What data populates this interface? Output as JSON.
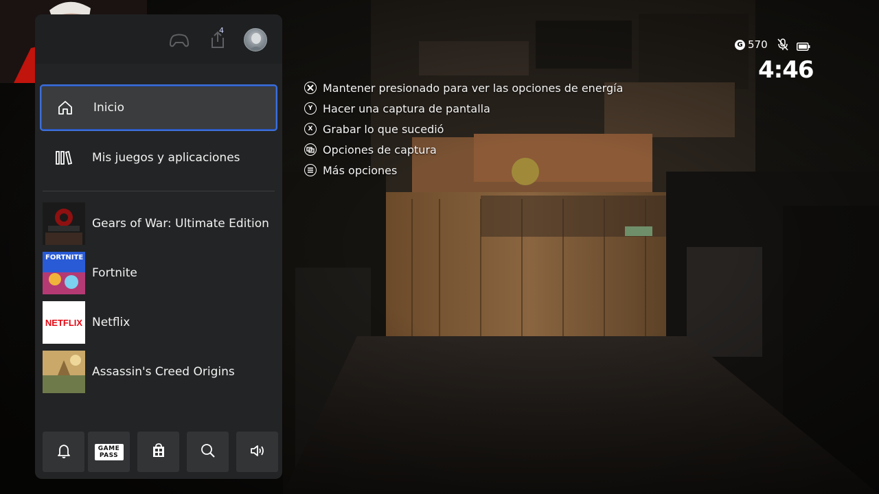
{
  "guide": {
    "notification_count": "4",
    "nav": [
      {
        "label": "Inicio",
        "icon": "home-icon"
      },
      {
        "label": "Mis juegos y aplicaciones",
        "icon": "library-icon"
      }
    ],
    "recent": [
      {
        "label": "Gears of War: Ultimate Edition",
        "thumb": "gears-of-war-thumbnail"
      },
      {
        "label": "Fortnite",
        "thumb": "fortnite-thumbnail",
        "thumb_text": "FORTNITE"
      },
      {
        "label": "Netflix",
        "thumb": "netflix-thumbnail",
        "thumb_text": "NETFLIX"
      },
      {
        "label": "Assassin's Creed Origins",
        "thumb": "assassins-creed-thumbnail"
      }
    ],
    "bottom_bar": {
      "notifications_icon": "bell-icon",
      "gamepass_line1": "GAME",
      "gamepass_line2": "PASS",
      "store_icon": "store-icon",
      "search_icon": "search-icon",
      "audio_icon": "speaker-icon"
    }
  },
  "hints": [
    {
      "button": "xbox",
      "text": "Mantener presionado para ver las opciones de energía"
    },
    {
      "button": "Y",
      "text": "Hacer una captura de pantalla"
    },
    {
      "button": "X",
      "text": "Grabar lo que sucedió"
    },
    {
      "button": "view",
      "text": "Opciones de captura"
    },
    {
      "button": "menu",
      "text": "Más opciones"
    }
  ],
  "status": {
    "gamerscore_symbol": "G",
    "gamerscore": "570",
    "mic_icon": "mic-muted-icon",
    "battery_icon": "battery-icon",
    "time": "4:46"
  },
  "colors": {
    "focus_border": "#3c6fd8",
    "panel_bg": "#232425",
    "selected_bg": "#3b3c3d",
    "netflix_red": "#e50914"
  }
}
